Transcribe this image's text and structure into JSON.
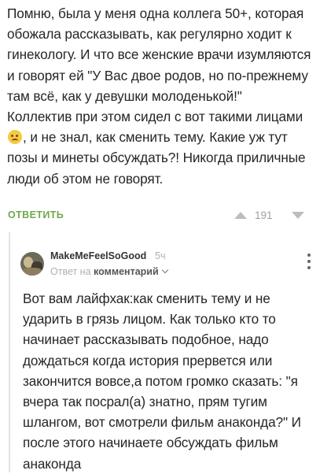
{
  "post": {
    "text_part1": "Помню, была у меня одна коллега 50+, которая обожала рассказывать, как регулярно ходит к гинекологу. И что все женские врачи изумляются и говорят ей \"У Вас двое родов, но по-прежнему там всё, как у девушки молоденькой!\"",
    "text_part2_before_emoji": "Коллектив при этом сидел с вот такими лицами",
    "emoji": "smiling-face",
    "text_part2_after_emoji": ", и не знал, как сменить тему. Какие уж тут позы и минеты обсуждать?! Никогда приличные люди об этом не говорят.",
    "reply_label": "ОТВЕТИТЬ",
    "rating": "191"
  },
  "comment": {
    "username": "MakeMeFeelSoGood",
    "time_ago": "5ч",
    "reply_to_prefix": "Ответ на",
    "reply_to_link": "комментарий",
    "text": "Вот вам лайфхак:как сменить тему и не ударить в грязь лицом. Как только кто то начинает рассказывать подобное, надо дождаться когда история прервется или закончится вовсе,а потом громко сказать: \"я вчера так посрал(а) знатно, прям тугим шлангом, вот смотрели фильм анаконда?\" И после этого начинаете обсуждать фильм анаконда"
  },
  "colors": {
    "accent_green": "#6ea84c",
    "muted_gray": "#b0b0b0",
    "vote_arrow": "#bdbdbd"
  }
}
